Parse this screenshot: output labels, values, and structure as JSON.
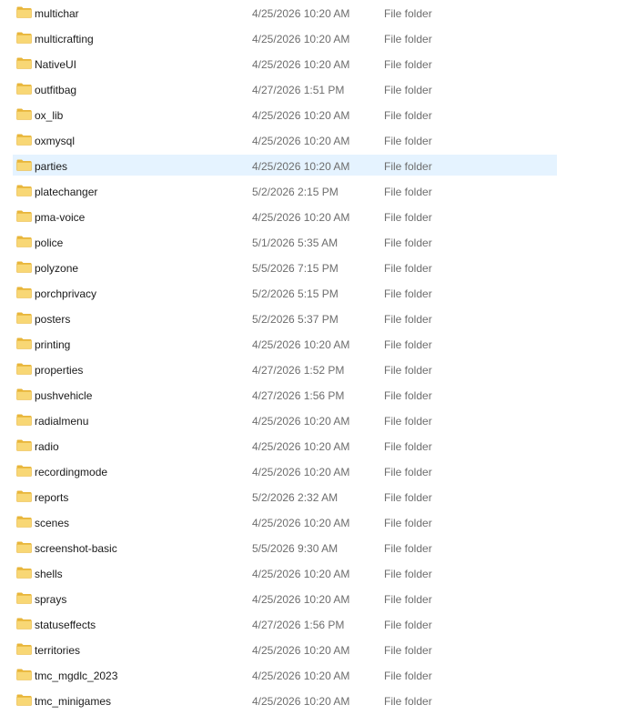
{
  "file_list": {
    "folder_icon": "folder-icon",
    "colors": {
      "folder_body": "#f8d775",
      "folder_back": "#e8b53a",
      "selected_row": "#e5f3ff",
      "secondary_text": "#6d6d6d"
    },
    "rows": [
      {
        "name": "multichar",
        "date": "4/25/2026 10:20 AM",
        "type": "File folder"
      },
      {
        "name": "multicrafting",
        "date": "4/25/2026 10:20 AM",
        "type": "File folder"
      },
      {
        "name": "NativeUI",
        "date": "4/25/2026 10:20 AM",
        "type": "File folder"
      },
      {
        "name": "outfitbag",
        "date": "4/27/2026 1:51 PM",
        "type": "File folder"
      },
      {
        "name": "ox_lib",
        "date": "4/25/2026 10:20 AM",
        "type": "File folder"
      },
      {
        "name": "oxmysql",
        "date": "4/25/2026 10:20 AM",
        "type": "File folder"
      },
      {
        "name": "parties",
        "date": "4/25/2026 10:20 AM",
        "type": "File folder",
        "selected": true
      },
      {
        "name": "platechanger",
        "date": "5/2/2026 2:15 PM",
        "type": "File folder"
      },
      {
        "name": "pma-voice",
        "date": "4/25/2026 10:20 AM",
        "type": "File folder"
      },
      {
        "name": "police",
        "date": "5/1/2026 5:35 AM",
        "type": "File folder"
      },
      {
        "name": "polyzone",
        "date": "5/5/2026 7:15 PM",
        "type": "File folder"
      },
      {
        "name": "porchprivacy",
        "date": "5/2/2026 5:15 PM",
        "type": "File folder"
      },
      {
        "name": "posters",
        "date": "5/2/2026 5:37 PM",
        "type": "File folder"
      },
      {
        "name": "printing",
        "date": "4/25/2026 10:20 AM",
        "type": "File folder"
      },
      {
        "name": "properties",
        "date": "4/27/2026 1:52 PM",
        "type": "File folder"
      },
      {
        "name": "pushvehicle",
        "date": "4/27/2026 1:56 PM",
        "type": "File folder"
      },
      {
        "name": "radialmenu",
        "date": "4/25/2026 10:20 AM",
        "type": "File folder"
      },
      {
        "name": "radio",
        "date": "4/25/2026 10:20 AM",
        "type": "File folder"
      },
      {
        "name": "recordingmode",
        "date": "4/25/2026 10:20 AM",
        "type": "File folder"
      },
      {
        "name": "reports",
        "date": "5/2/2026 2:32 AM",
        "type": "File folder"
      },
      {
        "name": "scenes",
        "date": "4/25/2026 10:20 AM",
        "type": "File folder"
      },
      {
        "name": "screenshot-basic",
        "date": "5/5/2026 9:30 AM",
        "type": "File folder"
      },
      {
        "name": "shells",
        "date": "4/25/2026 10:20 AM",
        "type": "File folder"
      },
      {
        "name": "sprays",
        "date": "4/25/2026 10:20 AM",
        "type": "File folder"
      },
      {
        "name": "statuseffects",
        "date": "4/27/2026 1:56 PM",
        "type": "File folder"
      },
      {
        "name": "territories",
        "date": "4/25/2026 10:20 AM",
        "type": "File folder"
      },
      {
        "name": "tmc_mgdlc_2023",
        "date": "4/25/2026 10:20 AM",
        "type": "File folder"
      },
      {
        "name": "tmc_minigames",
        "date": "4/25/2026 10:20 AM",
        "type": "File folder"
      }
    ]
  }
}
